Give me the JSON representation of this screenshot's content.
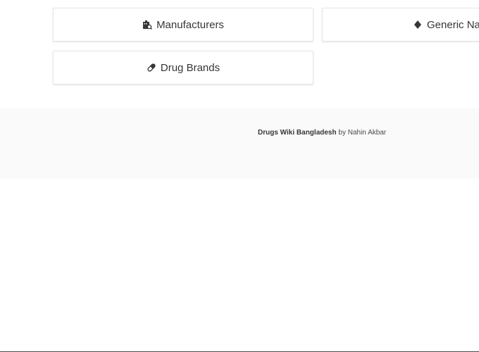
{
  "cards": {
    "manufacturers": {
      "label": "Manufacturers",
      "icon": "building-search-icon"
    },
    "generic_names": {
      "label": "Generic Names",
      "icon": "diamond-icon"
    },
    "drug_brands": {
      "label": "Drug Brands",
      "icon": "capsule-icon"
    }
  },
  "footer": {
    "site_name": "Drugs Wiki Bangladesh",
    "by_text": " by ",
    "author": "Nahin Akbar"
  },
  "colors": {
    "text": "#363636",
    "footer_bg": "#fafafa",
    "card_border": "#e6e6e6"
  }
}
